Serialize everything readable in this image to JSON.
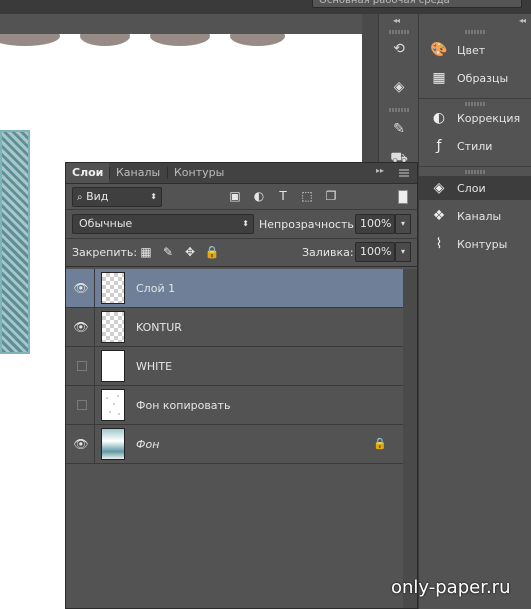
{
  "workspace": {
    "selector_label": "Основная рабочая среда"
  },
  "right_dock": {
    "items": [
      {
        "label": "Цвет",
        "icon": "palette-icon"
      },
      {
        "label": "Образцы",
        "icon": "swatches-grid-icon"
      },
      {
        "label": "Коррекция",
        "icon": "adjustments-icon"
      },
      {
        "label": "Стили",
        "icon": "styles-fx-icon"
      },
      {
        "label": "Слои",
        "icon": "layers-icon"
      },
      {
        "label": "Каналы",
        "icon": "channels-icon"
      },
      {
        "label": "Контуры",
        "icon": "paths-icon"
      }
    ]
  },
  "layers_panel": {
    "tabs": [
      "Слои",
      "Каналы",
      "Контуры"
    ],
    "active_tab": "Слои",
    "filter": {
      "icon": "search-icon",
      "value": "Вид"
    },
    "blend_mode": "Обычные",
    "opacity_label": "Непрозрачность:",
    "opacity_value": "100%",
    "lock_label": "Закрепить:",
    "fill_label": "Заливка:",
    "fill_value": "100%",
    "layers": [
      {
        "name": "Слой 1",
        "visible": true,
        "selected": true,
        "thumb": "transparent",
        "italic": false,
        "locked": false
      },
      {
        "name": "KONTUR",
        "visible": true,
        "selected": false,
        "thumb": "transparent",
        "italic": false,
        "locked": false
      },
      {
        "name": "WHITE",
        "visible": false,
        "selected": false,
        "thumb": "white",
        "italic": false,
        "locked": false
      },
      {
        "name": "Фон копировать",
        "visible": false,
        "selected": false,
        "thumb": "speckled",
        "italic": false,
        "locked": false
      },
      {
        "name": "Фон",
        "visible": true,
        "selected": false,
        "thumb": "image",
        "italic": true,
        "locked": true
      }
    ]
  },
  "colors": {
    "selected_row": "#6e7f97",
    "panel_bg": "#535353"
  },
  "watermark": "only-paper.ru"
}
